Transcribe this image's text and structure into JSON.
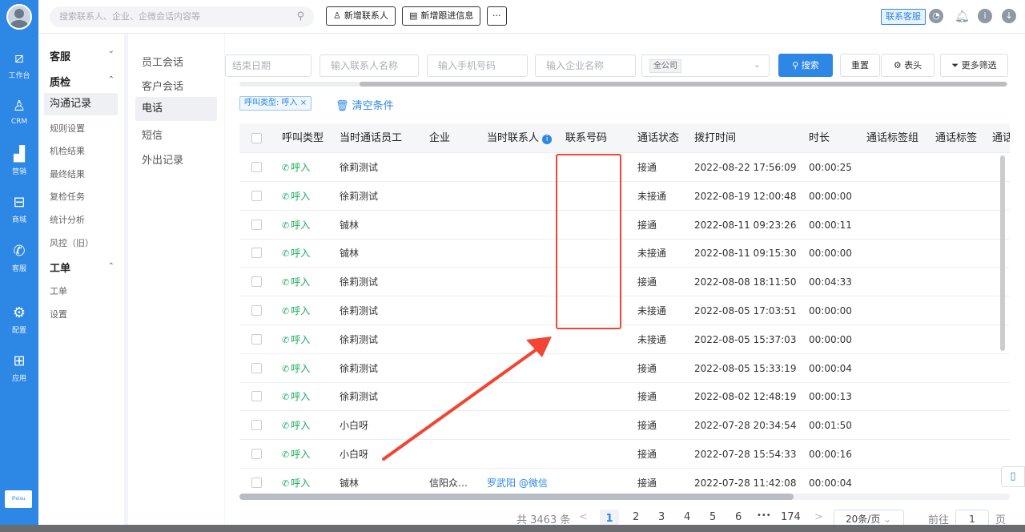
{
  "rail": {
    "items": [
      {
        "icon": "workbench-icon",
        "label": "工作台",
        "glyph": "⧄"
      },
      {
        "icon": "crm-icon",
        "label": "CRM",
        "glyph": "♙"
      },
      {
        "icon": "marketing-icon",
        "label": "营销",
        "glyph": "▟"
      },
      {
        "icon": "mall-icon",
        "label": "商城",
        "glyph": "⊟"
      },
      {
        "icon": "service-icon",
        "label": "客服",
        "glyph": "✆"
      },
      {
        "icon": "config-icon",
        "label": "配置",
        "glyph": "⚙"
      },
      {
        "icon": "apps-icon",
        "label": "应用",
        "glyph": "⊞"
      }
    ],
    "logo": "iFeisu"
  },
  "topbar": {
    "search_placeholder": "搜索联系人、企业、企微会话内容等",
    "add_contact": "新增联系人",
    "add_followup": "新增跟进信息",
    "more": "···",
    "service_tag": "联系客服"
  },
  "menu": {
    "groups": [
      {
        "label": "客服",
        "arrow": "⌄"
      },
      {
        "label": "质检",
        "arrow": "⌃"
      },
      {
        "label": "工单",
        "arrow": "⌃"
      }
    ],
    "items_qc": [
      "沟通记录",
      "规则设置",
      "机检结果",
      "最终结果",
      "复检任务",
      "统计分析",
      "风控（旧）"
    ],
    "items_ticket": [
      "工单",
      "设置"
    ]
  },
  "submenu": [
    "员工会话",
    "客户会话",
    "电话",
    "短信",
    "外出记录"
  ],
  "filters": {
    "end_date": "结束日期",
    "contact_name": "输入联系人名称",
    "phone": "输入手机号码",
    "company": "输入企业名称",
    "scope": "全公司",
    "search": "搜索",
    "reset": "重置",
    "columns": "表头",
    "more_filters": "更多筛选",
    "active_tag": "呼叫类型: 呼入 ×",
    "clear": "清空条件"
  },
  "table": {
    "headers": [
      "呼叫类型",
      "当时通话员工",
      "企业",
      "当时联系人",
      "联系号码",
      "通话状态",
      "拨打时间",
      "时长",
      "通话标签组",
      "通话标签",
      "通话"
    ],
    "rows": [
      {
        "type": "呼入",
        "staff": "徐莉测试",
        "company": "",
        "contact": "",
        "number": "",
        "status": "接通",
        "time": "2022-08-22 17:56:09",
        "duration": "00:00:25"
      },
      {
        "type": "呼入",
        "staff": "徐莉测试",
        "company": "",
        "contact": "",
        "number": "",
        "status": "未接通",
        "time": "2022-08-19 12:00:48",
        "duration": "00:00:00"
      },
      {
        "type": "呼入",
        "staff": "铖林",
        "company": "",
        "contact": "",
        "number": "",
        "status": "接通",
        "time": "2022-08-11 09:23:26",
        "duration": "00:00:11"
      },
      {
        "type": "呼入",
        "staff": "铖林",
        "company": "",
        "contact": "",
        "number": "",
        "status": "未接通",
        "time": "2022-08-11 09:15:30",
        "duration": "00:00:00"
      },
      {
        "type": "呼入",
        "staff": "徐莉测试",
        "company": "",
        "contact": "",
        "number": "",
        "status": "接通",
        "time": "2022-08-08 18:11:50",
        "duration": "00:04:33"
      },
      {
        "type": "呼入",
        "staff": "徐莉测试",
        "company": "",
        "contact": "",
        "number": "",
        "status": "未接通",
        "time": "2022-08-05 17:03:51",
        "duration": "00:00:00"
      },
      {
        "type": "呼入",
        "staff": "徐莉测试",
        "company": "",
        "contact": "",
        "number": "",
        "status": "未接通",
        "time": "2022-08-05 15:37:03",
        "duration": "00:00:00"
      },
      {
        "type": "呼入",
        "staff": "徐莉测试",
        "company": "",
        "contact": "",
        "number": "",
        "status": "接通",
        "time": "2022-08-05 15:33:19",
        "duration": "00:00:04"
      },
      {
        "type": "呼入",
        "staff": "徐莉测试",
        "company": "",
        "contact": "",
        "number": "",
        "status": "接通",
        "time": "2022-08-02 12:48:19",
        "duration": "00:00:13"
      },
      {
        "type": "呼入",
        "staff": "小白呀",
        "company": "",
        "contact": "",
        "number": "",
        "status": "接通",
        "time": "2022-07-28 20:34:54",
        "duration": "00:01:50"
      },
      {
        "type": "呼入",
        "staff": "小白呀",
        "company": "",
        "contact": "",
        "number": "",
        "status": "接通",
        "time": "2022-07-28 15:54:33",
        "duration": "00:00:16"
      },
      {
        "type": "呼入",
        "staff": "铖林",
        "company": "信阳众…",
        "contact": "罗武阳 @微信",
        "number": "",
        "status": "接通",
        "time": "2022-07-28 11:42:08",
        "duration": "00:00:04"
      }
    ]
  },
  "pagination": {
    "total": "共 3463 条",
    "prev": "<",
    "pages": [
      "1",
      "2",
      "3",
      "4",
      "5",
      "6",
      "•••",
      "174"
    ],
    "next": ">",
    "page_size": "20条/页",
    "goto": "前往",
    "goto_value": "1",
    "page_unit": "页"
  },
  "colors": {
    "accent": "#2d87e5",
    "call_green": "#1aad58",
    "annotation_red": "#f24533"
  }
}
